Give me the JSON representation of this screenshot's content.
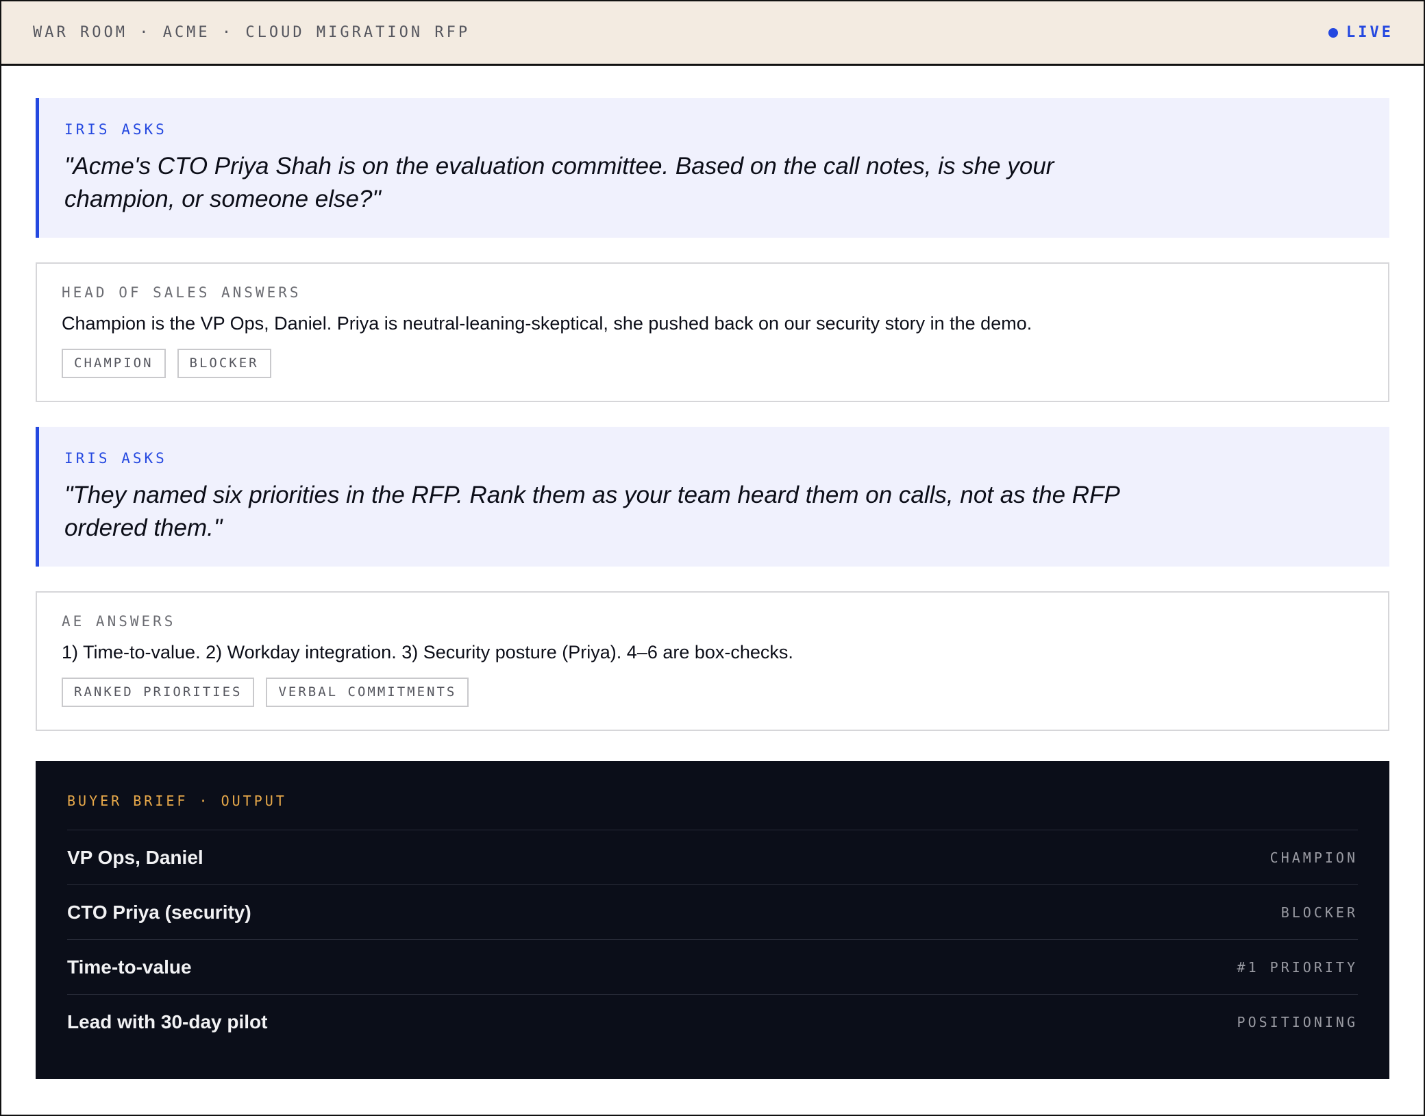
{
  "topbar": {
    "title": "WAR ROOM · ACME · CLOUD MIGRATION RFP",
    "live_label": "LIVE"
  },
  "exchanges": [
    {
      "ask_label": "IRIS ASKS",
      "ask_quote": "\"Acme's CTO Priya Shah is on the evaluation committee. Based on the call notes, is she your champion, or someone else?\"",
      "answer_label": "HEAD OF SALES ANSWERS",
      "answer_text": "Champion is the VP Ops, Daniel. Priya is neutral-leaning-skeptical, she pushed back on our security story in the demo.",
      "tags": [
        "CHAMPION",
        "BLOCKER"
      ]
    },
    {
      "ask_label": "IRIS ASKS",
      "ask_quote": "\"They named six priorities in the RFP. Rank them as your team heard them on calls, not as the RFP ordered them.\"",
      "answer_label": "AE ANSWERS",
      "answer_text": "1) Time-to-value. 2) Workday integration. 3) Security posture (Priya). 4–6 are box-checks.",
      "tags": [
        "RANKED PRIORITIES",
        "VERBAL COMMITMENTS"
      ]
    }
  ],
  "brief": {
    "label": "BUYER BRIEF · OUTPUT",
    "rows": [
      {
        "key": "VP Ops, Daniel",
        "value": "CHAMPION"
      },
      {
        "key": "CTO Priya (security)",
        "value": "BLOCKER"
      },
      {
        "key": "Time-to-value",
        "value": "#1 PRIORITY"
      },
      {
        "key": "Lead with 30-day pilot",
        "value": "POSITIONING"
      }
    ]
  },
  "colors": {
    "accent": "#2448e0",
    "brief_accent": "#e8a94a",
    "topbar_bg": "#f3ebe1",
    "ask_bg": "#f0f1fd",
    "brief_bg": "#0b0e19"
  },
  "icons": {
    "live": "live-dot-icon"
  }
}
